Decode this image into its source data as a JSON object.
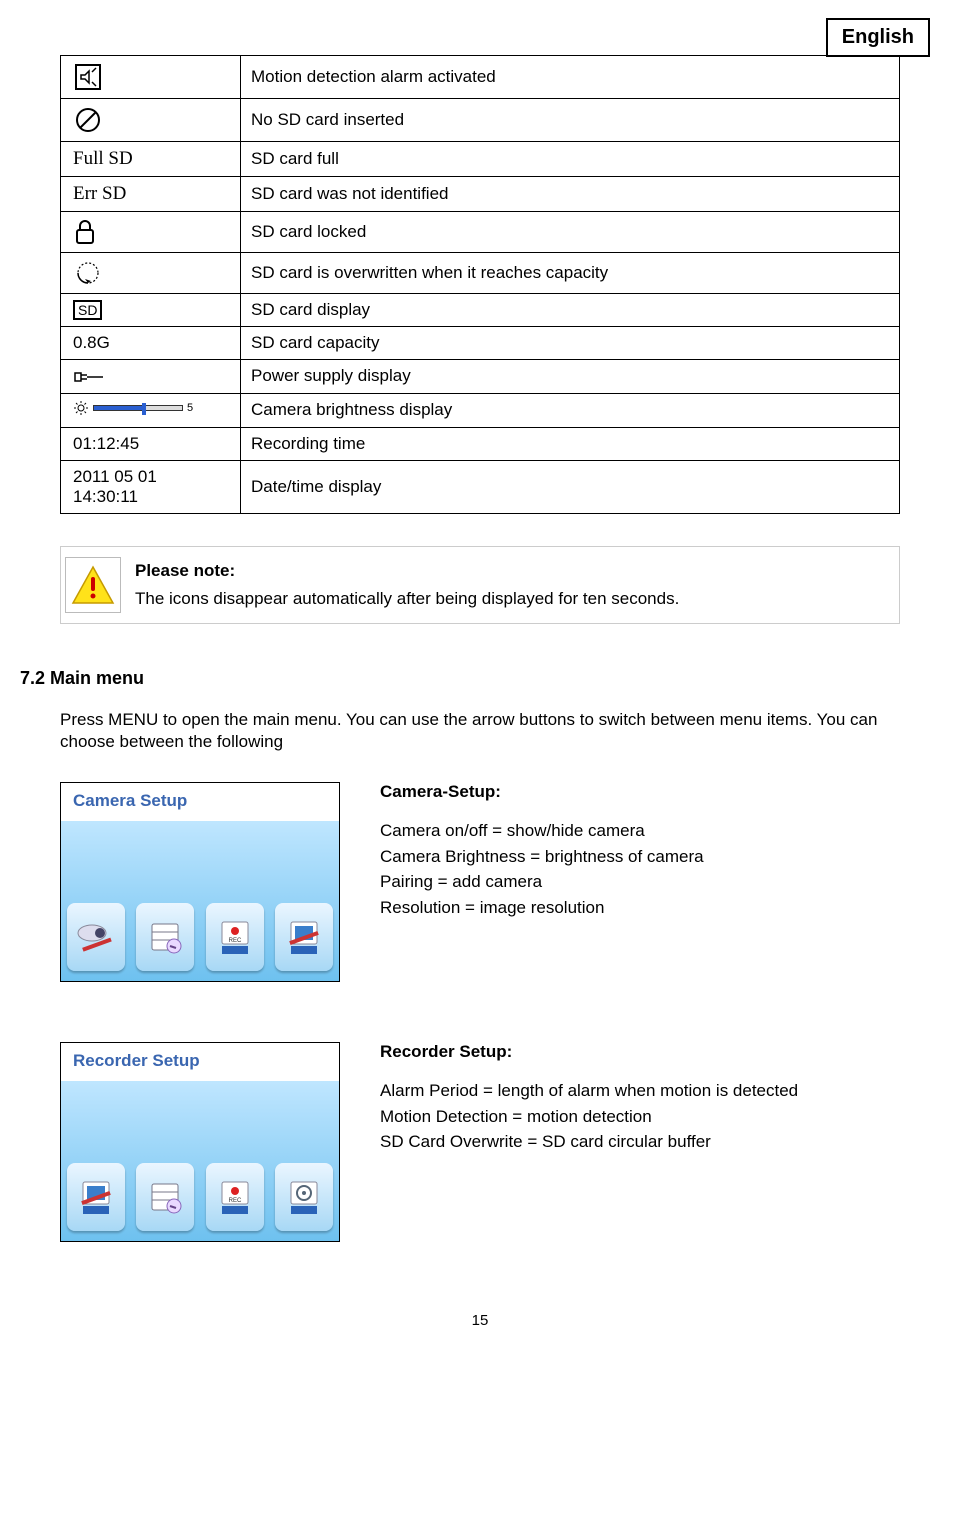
{
  "header": {
    "language": "English"
  },
  "icon_table": {
    "rows": [
      {
        "icon_text": "",
        "icon_type": "speaker",
        "desc": "Motion detection alarm activated"
      },
      {
        "icon_text": "",
        "icon_type": "no-circle",
        "desc": "No SD card inserted"
      },
      {
        "icon_text": "Full SD",
        "icon_type": "text-serif",
        "desc": "SD card full"
      },
      {
        "icon_text": "Err SD",
        "icon_type": "text-serif",
        "desc": "SD card was not identified"
      },
      {
        "icon_text": "",
        "icon_type": "lock",
        "desc": "SD card locked"
      },
      {
        "icon_text": "",
        "icon_type": "cycle",
        "desc": "SD card is overwritten when it reaches capacity"
      },
      {
        "icon_text": "SD",
        "icon_type": "sd-box",
        "desc": "SD card display"
      },
      {
        "icon_text": "0.8G",
        "icon_type": "text",
        "desc": "SD card capacity"
      },
      {
        "icon_text": "",
        "icon_type": "plug",
        "desc": "Power supply display"
      },
      {
        "icon_text": "5",
        "icon_type": "brightness-slider",
        "desc": "Camera brightness display"
      },
      {
        "icon_text": "01:12:45",
        "icon_type": "text",
        "desc": "Recording time"
      },
      {
        "icon_text": "2011 05 01\n14:30:11",
        "icon_type": "text-multiline",
        "desc": "Date/time display"
      }
    ]
  },
  "note": {
    "title": "Please note:",
    "body": "The icons disappear automatically after being displayed for ten seconds."
  },
  "section": {
    "heading": "7.2 Main menu",
    "intro": "Press MENU to open the main menu. You can use the arrow buttons to switch between menu items. You can choose between the following"
  },
  "camera_setup": {
    "screenshot_title": "Camera Setup",
    "title": "Camera-Setup:",
    "lines": [
      "Camera on/off = show/hide camera",
      "Camera Brightness = brightness of camera",
      "Pairing = add camera",
      "Resolution = image resolution"
    ]
  },
  "recorder_setup": {
    "screenshot_title": "Recorder Setup",
    "title": "Recorder Setup:",
    "lines": [
      "Alarm Period = length of alarm when motion is detected",
      "Motion Detection = motion detection",
      "SD Card Overwrite = SD card circular buffer"
    ]
  },
  "page_number": "15"
}
